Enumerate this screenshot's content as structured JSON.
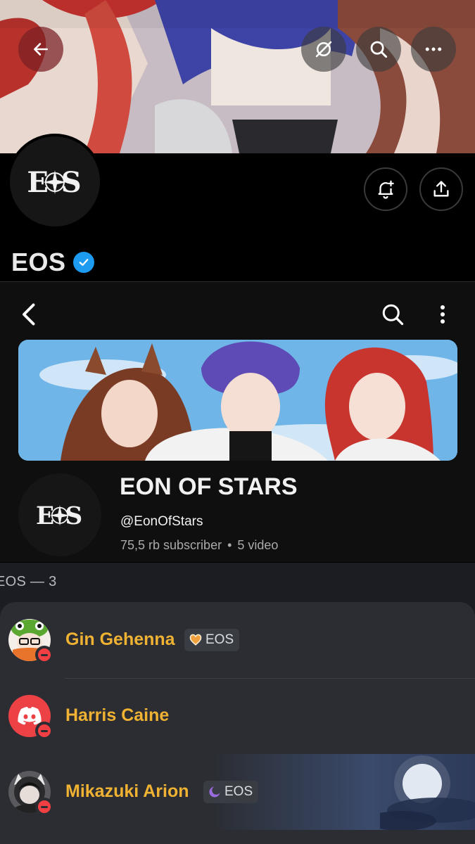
{
  "profile": {
    "name": "EOS",
    "logo_text": "EOS",
    "icons": {
      "back": "back-arrow-icon",
      "visibility": "eye-slash-icon",
      "search": "search-icon",
      "more": "more-horizontal-icon",
      "notify": "bell-plus-icon",
      "share": "share-icon",
      "verified": "verified-badge-icon"
    }
  },
  "channel": {
    "title": "EON OF STARS",
    "handle": "@EonOfStars",
    "subscribers": "75,5 rb subscriber",
    "separator": "•",
    "videos": "5 video",
    "logo_text": "EOS"
  },
  "members": {
    "group_header": "EOS — 3",
    "list": [
      {
        "name": "Gin Gehenna",
        "tag": "EOS",
        "tag_icon": "orange-heart-icon",
        "status": "do-not-disturb"
      },
      {
        "name": "Harris Caine",
        "tag": "",
        "tag_icon": "",
        "status": "do-not-disturb"
      },
      {
        "name": "Mikazuki Arion",
        "tag": "EOS",
        "tag_icon": "purple-moon-icon",
        "status": "do-not-disturb"
      }
    ]
  },
  "colors": {
    "member_name": "#f0b232",
    "dnd": "#f23f43",
    "verified": "#1d9bf0",
    "discord_blurple": "#ed4245"
  }
}
